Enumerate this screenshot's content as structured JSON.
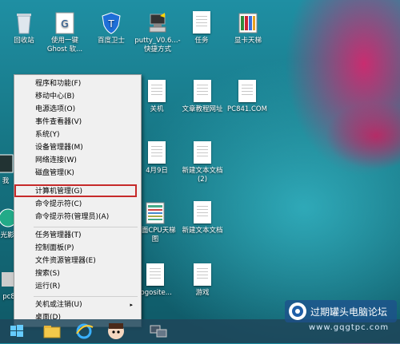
{
  "desktop_icons": [
    {
      "id": "recycle",
      "label": "回收站",
      "kind": "recycle"
    },
    {
      "id": "ghost",
      "label": "使用一键Ghost 软...",
      "kind": "ghost"
    },
    {
      "id": "baidu",
      "label": "百度卫士",
      "kind": "shield"
    },
    {
      "id": "putty",
      "label": "putty_V0.6...- 快捷方式",
      "kind": "putty"
    },
    {
      "id": "task",
      "label": "任务",
      "kind": "doc"
    },
    {
      "id": "display",
      "label": "显卡天梯",
      "kind": "display"
    },
    {
      "id": "shutdown",
      "label": "关机",
      "kind": "doc"
    },
    {
      "id": "tutorial",
      "label": "文章教程网址",
      "kind": "doc"
    },
    {
      "id": "pc841",
      "label": "PC841.COM",
      "kind": "doc"
    },
    {
      "id": "apr9",
      "label": "4月9日",
      "kind": "doc"
    },
    {
      "id": "newtext2",
      "label": "新建文本文档 (2)",
      "kind": "doc"
    },
    {
      "id": "desktopcpu",
      "label": "桌面CPU天梯图",
      "kind": "img"
    },
    {
      "id": "newtext",
      "label": "新建文本文档",
      "kind": "doc"
    },
    {
      "id": "logosite",
      "label": "logosite...",
      "kind": "doc"
    },
    {
      "id": "game",
      "label": "游戏",
      "kind": "doc"
    },
    {
      "id": "frag1",
      "label": "我",
      "kind": "frag"
    },
    {
      "id": "frag2",
      "label": "光影",
      "kind": "frag"
    },
    {
      "id": "frag3",
      "label": "pc8",
      "kind": "frag"
    }
  ],
  "context_menu": {
    "items": [
      {
        "label": "程序和功能(F)"
      },
      {
        "label": "移动中心(B)"
      },
      {
        "label": "电源选项(O)"
      },
      {
        "label": "事件查看器(V)"
      },
      {
        "label": "系统(Y)"
      },
      {
        "label": "设备管理器(M)"
      },
      {
        "label": "网络连接(W)"
      },
      {
        "label": "磁盘管理(K)"
      },
      {
        "label": "计算机管理(G)"
      },
      {
        "label": "命令提示符(C)"
      },
      {
        "label": "命令提示符(管理员)(A)"
      },
      {
        "label": "任务管理器(T)"
      },
      {
        "label": "控制面板(P)"
      },
      {
        "label": "文件资源管理器(E)"
      },
      {
        "label": "搜索(S)"
      },
      {
        "label": "运行(R)"
      },
      {
        "label": "关机或注销(U)",
        "arrow": "▸"
      },
      {
        "label": "桌面(D)"
      }
    ],
    "highlighted": "计算机管理(G)"
  },
  "taskbar": {
    "items": [
      "start-button",
      "file-explorer",
      "internet-explorer",
      "app-character",
      "network-app"
    ]
  },
  "watermark": {
    "text": "过期罐头电脑论坛",
    "url": "www.gqgtpc.com"
  }
}
